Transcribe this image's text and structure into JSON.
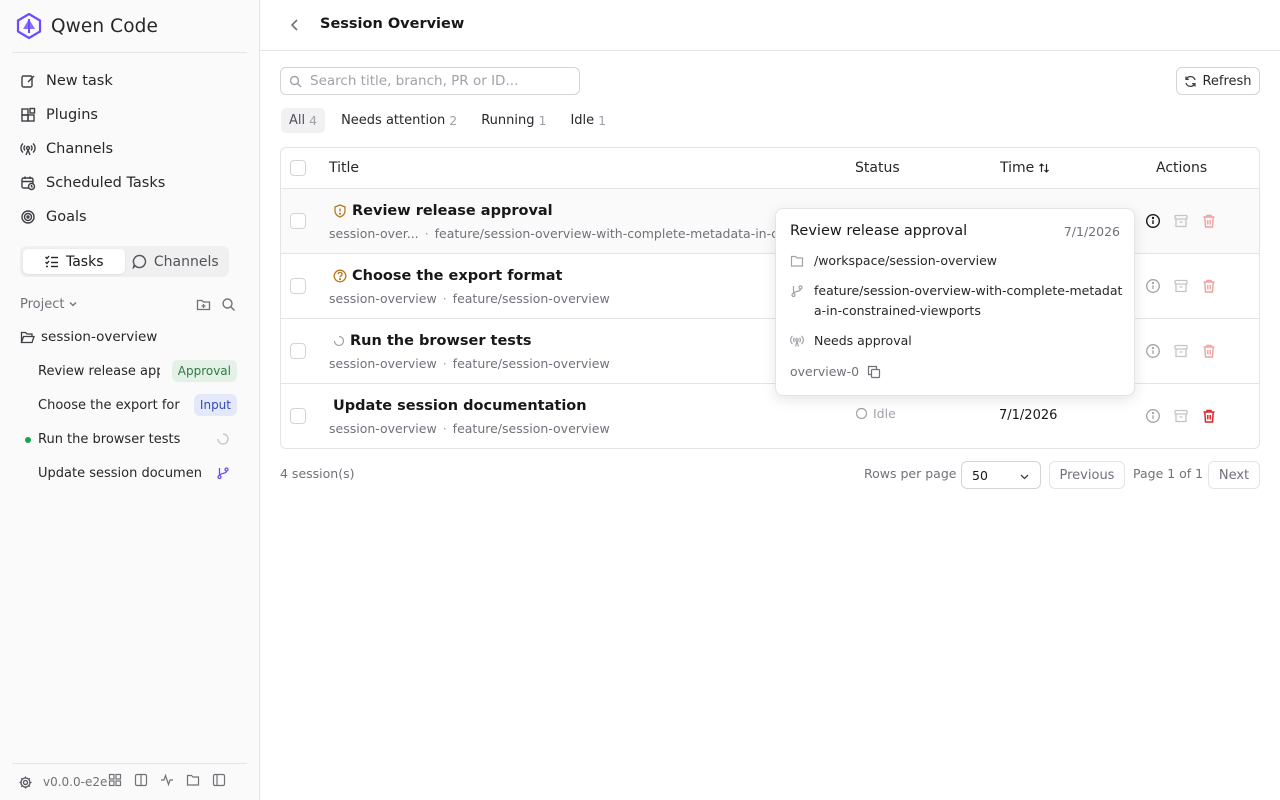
{
  "app": {
    "name": "Qwen Code",
    "version": "v0.0.0-e2e"
  },
  "nav": [
    {
      "label": "New task",
      "icon": "edit-icon"
    },
    {
      "label": "Plugins",
      "icon": "blocks-icon"
    },
    {
      "label": "Channels",
      "icon": "radio-icon"
    },
    {
      "label": "Scheduled Tasks",
      "icon": "calendar-clock-icon"
    },
    {
      "label": "Goals",
      "icon": "target-icon"
    }
  ],
  "sidebar_tabs": {
    "tasks": "Tasks",
    "channels": "Channels",
    "active": "Tasks"
  },
  "project": {
    "label": "Project",
    "folder": "session-overview"
  },
  "sidebar_sessions": [
    {
      "title": "Review release app",
      "badge": "Approval"
    },
    {
      "title": "Choose the export for",
      "badge": "Input"
    },
    {
      "title": "Run the browser tests",
      "running": true
    },
    {
      "title": "Update session documen",
      "indicator": "git-branch-icon"
    }
  ],
  "header": {
    "title": "Session Overview"
  },
  "search": {
    "placeholder": "Search title, branch, PR or ID..."
  },
  "refresh_label": "Refresh",
  "filters": [
    {
      "label": "All",
      "count": "4",
      "active": true
    },
    {
      "label": "Needs attention",
      "count": "2"
    },
    {
      "label": "Running",
      "count": "1"
    },
    {
      "label": "Idle",
      "count": "1"
    }
  ],
  "table": {
    "columns": {
      "title": "Title",
      "status": "Status",
      "time": "Time",
      "actions": "Actions"
    },
    "rows": [
      {
        "title": "Review release approval",
        "project": "session-over...",
        "branch": "feature/session-overview-with-complete-metadata-in-cor",
        "status": "",
        "time": "",
        "icon": "shield-alert-icon"
      },
      {
        "title": "Choose the export format",
        "project": "session-overview",
        "branch": "feature/session-overview",
        "status": "",
        "time": "",
        "icon": "question-circle-icon"
      },
      {
        "title": "Run the browser tests",
        "project": "session-overview",
        "branch": "feature/session-overview",
        "status": "",
        "time": "",
        "icon": "spinner-icon"
      },
      {
        "title": "Update session documentation",
        "project": "session-overview",
        "branch": "feature/session-overview",
        "status": "Idle",
        "time": "7/1/2026",
        "icon": ""
      }
    ]
  },
  "footer": {
    "count": "4 session(s)",
    "rows_per_page_label": "Rows per page",
    "rows_per_page": "50",
    "prev": "Previous",
    "page_info": "Page 1 of 1",
    "next": "Next"
  },
  "popover": {
    "title": "Review release approval",
    "date": "7/1/2026",
    "path": "/workspace/session-overview",
    "branch": "feature/session-overview-with-complete-metadata-in-constrained-viewports",
    "channel": "Needs approval",
    "id": "overview-0"
  },
  "colors": {
    "accent": "#6d4aff",
    "danger": "#dc2626",
    "approval_bg": "#e3f1e6",
    "input_bg": "#e3e8fb"
  }
}
